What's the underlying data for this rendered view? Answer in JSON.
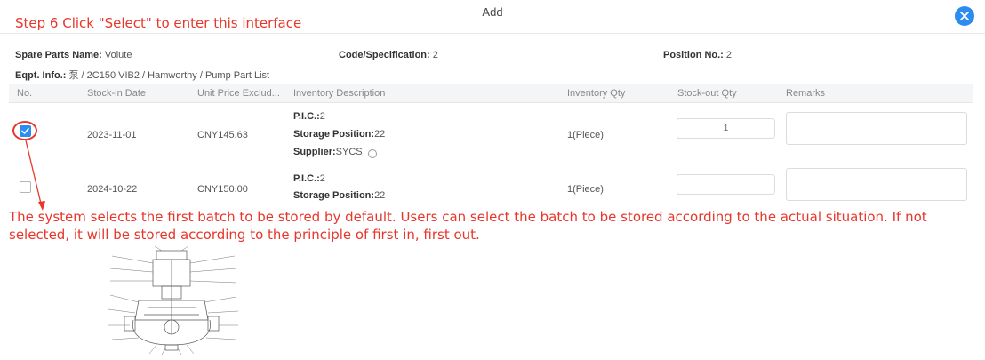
{
  "step_note": "Step 6 Click \"Select\" to enter this interface",
  "dialog": {
    "title": "Add",
    "close_icon": "close-icon"
  },
  "info": {
    "spare_parts_name_label": "Spare Parts Name:",
    "spare_parts_name_value": "Volute",
    "code_spec_label": "Code/Specification:",
    "code_spec_value": "2",
    "position_no_label": "Position No.:",
    "position_no_value": "2",
    "eqpt_info_label": "Eqpt. Info.:",
    "eqpt_info_value": "泵 / 2C150 VIB2 / Hamworthy / Pump Part List"
  },
  "table": {
    "headers": [
      "No.",
      "Stock-in Date",
      "Unit Price Exclud...",
      "Inventory Description",
      "Inventory Qty",
      "Stock-out Qty",
      "Remarks"
    ],
    "rows": [
      {
        "checked": true,
        "stock_in_date": "2023-11-01",
        "unit_price": "CNY145.63",
        "pic_label": "P.I.C.:",
        "pic_value": "2",
        "storage_label": "Storage Position:",
        "storage_value": "22",
        "supplier_label": "Supplier:",
        "supplier_value": "SYCS",
        "info_icon": "ⓘ",
        "inventory_qty": "1(Piece)",
        "stock_out_qty": "1",
        "remarks": ""
      },
      {
        "checked": false,
        "stock_in_date": "2024-10-22",
        "unit_price": "CNY150.00",
        "pic_label": "P.I.C.:",
        "pic_value": "2",
        "storage_label": "Storage Position:",
        "storage_value": "22",
        "inventory_qty": "1(Piece)",
        "stock_out_qty": "",
        "remarks": ""
      }
    ]
  },
  "annotation": "The system selects the first batch to be stored by default. Users can select the batch to be stored according to the actual situation. If not selected, it will be stored according to the principle of first in, first out.",
  "colors": {
    "annotation_red": "#e8362b",
    "accent_blue": "#2d8cf0"
  }
}
